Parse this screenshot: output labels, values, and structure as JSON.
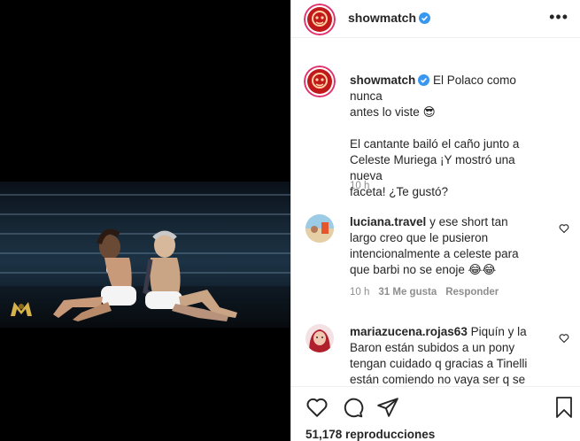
{
  "post": {
    "username": "showmatch",
    "verified": true
  },
  "caption": {
    "username": "showmatch",
    "line1": "El Polaco como nunca",
    "line2": "antes lo viste",
    "emoji": "😎",
    "body": [
      "El cantante bailó el caño junto a",
      "Celeste Muriega ¡Y mostró una nueva",
      "faceta! ¿Te gustó?"
    ],
    "time": "10 h"
  },
  "comments": [
    {
      "username": "luciana.travel",
      "lines": [
        "y ese short tan",
        "largo creo que le pusieron",
        "intencionalmente a celeste para",
        "que barbi no se enoje 😂😂"
      ],
      "time": "10 h",
      "likes": "31 Me gusta",
      "reply": "Responder"
    },
    {
      "username": "mariazucena.rojas63",
      "lines": [
        "Piquín y la",
        "Baron están subidos a un pony",
        "tengan cuidado q gracias a Tinelli",
        "están comiendo no vaya ser q se"
      ]
    }
  ],
  "footer": {
    "views": "51,178 reproducciones"
  },
  "colors": {
    "verified": "#3897f0",
    "meta": "#8e8e8e",
    "brand_ring": "#e1306c"
  }
}
